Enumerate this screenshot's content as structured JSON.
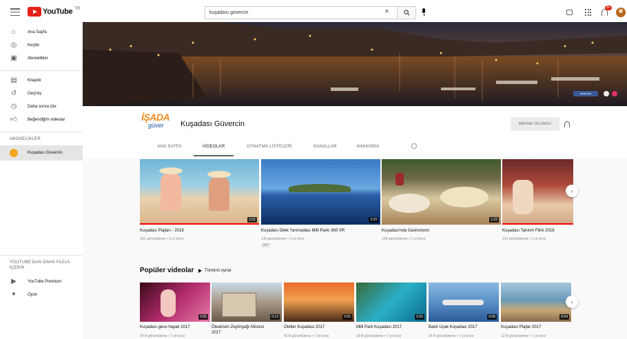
{
  "topbar": {
    "logo_text": "YouTube",
    "logo_tm": "TR",
    "search_value": "kuşadası güvercin",
    "notification_count": "9+"
  },
  "sidebar": {
    "primary": [
      {
        "label": "Ana Sayfa",
        "icon": "home-icon"
      },
      {
        "label": "Keşfet",
        "icon": "explore-icon"
      },
      {
        "label": "Abonelikler",
        "icon": "subscriptions-icon"
      }
    ],
    "secondary": [
      {
        "label": "Kitaplık",
        "icon": "library-icon"
      },
      {
        "label": "Geçmiş",
        "icon": "history-icon"
      },
      {
        "label": "Daha sonra izle",
        "icon": "watch-later-icon"
      },
      {
        "label": "Beğendiğim videolar",
        "icon": "like-icon"
      }
    ],
    "subscriptions_heading": "ABONELİKLER",
    "subscriptions": [
      {
        "label": "Kuşadası Güvercin"
      }
    ],
    "more_heading": "YOUTUBE'DAN DAHA FAZLA İÇERİK",
    "more": [
      {
        "label": "YouTube Premium",
        "icon": "youtube-premium-icon"
      },
      {
        "label": "Oyun",
        "icon": "gaming-icon"
      }
    ]
  },
  "channel": {
    "logo_main": "İŞADA",
    "logo_sub": "güver",
    "title": "Kuşadası Güvercin",
    "subscribe_label": "ABONE OLUNDU",
    "tabs": [
      {
        "label": "ANA SAYFA",
        "active": false
      },
      {
        "label": "VİDEOLAR",
        "active": true
      },
      {
        "label": "OYNATMA LİSTELERİ",
        "active": false
      },
      {
        "label": "KANALLAR",
        "active": false
      },
      {
        "label": "HAKKINDA",
        "active": false
      }
    ]
  },
  "videos_row1": [
    {
      "title": "Kuşadası Plajları - 2018",
      "meta": "262 görüntüleme • 3 yıl önce",
      "meta2": "",
      "duration": "1:01"
    },
    {
      "title": "Kuşadası Dilek Yarımadası Milli Parkı 360 VR",
      "meta": "3 B görüntüleme • 3 yıl önce",
      "meta2": "360°",
      "duration": "3:29"
    },
    {
      "title": "Kuşadası'nda Gastronomi",
      "meta": "128 görüntüleme • 1 yıl önce",
      "meta2": "",
      "duration": "1:22"
    },
    {
      "title": "Kuşadası Tanıtım Filmi 2018",
      "meta": "314 görüntüleme • 3 yıl önce",
      "meta2": "",
      "duration": ""
    }
  ],
  "popular": {
    "title": "Popüler videolar",
    "play_all": "Tümünü oynat",
    "videos": [
      {
        "title": "Kuşadası gece hayatı 2017",
        "title2": "",
        "meta": "54 B görüntüleme • 7 yıl önce",
        "duration": "0:55"
      },
      {
        "title": "Öleatrium Zeytinyağı Müzesi",
        "title2": "2017",
        "meta": "",
        "duration": "0:13"
      },
      {
        "title": "Oteller Kuşadası 2017",
        "title2": "",
        "meta": "42 B görüntüleme • 7 yıl önce",
        "duration": "0:55"
      },
      {
        "title": "Milli Park Kuşadası 2017",
        "title2": "",
        "meta": "39 B görüntüleme • 7 yıl önce",
        "duration": "0:55"
      },
      {
        "title": "Batık Uçak Kuşadası 2017",
        "title2": "",
        "meta": "24 B görüntüleme • 7 yıl önce",
        "duration": "0:56"
      },
      {
        "title": "Kuşadası Plajlar 2017",
        "title2": "",
        "meta": "12 B görüntüleme • 7 yıl önce",
        "duration": "0:54"
      }
    ]
  },
  "banner": {
    "social_label": "facebook"
  },
  "colors": {
    "accent_red": "#ff0000",
    "brand_orange": "#f08a1c",
    "brand_blue": "#1d4fa3"
  }
}
